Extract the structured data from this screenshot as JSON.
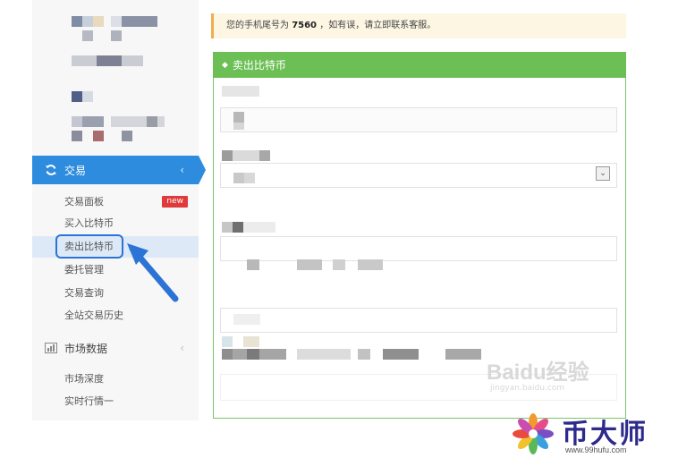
{
  "notice": {
    "prefix": "您的手机尾号为",
    "phone_tail": "7560",
    "suffix": "，如有误，请立即联系客服。"
  },
  "sidebar": {
    "trade_section": {
      "label": "交易",
      "chevron": "‹"
    },
    "trade_items": [
      {
        "label": "交易面板",
        "badge": "new"
      },
      {
        "label": "买入比特币"
      },
      {
        "label": "卖出比特币"
      },
      {
        "label": "委托管理"
      },
      {
        "label": "交易查询"
      },
      {
        "label": "全站交易历史"
      }
    ],
    "market_section": {
      "label": "市场数据",
      "chevron": "‹"
    },
    "market_items": [
      {
        "label": "市场深度"
      },
      {
        "label": "实时行情一"
      }
    ]
  },
  "panel": {
    "title": "卖出比特币",
    "select_indicator": "⌄"
  },
  "watermark": {
    "baidu": "Baidu经验",
    "baidu_url": "jingyan.baidu.com"
  },
  "brand": {
    "name": "币大师",
    "url": "www.99hufu.com"
  },
  "colors": {
    "sidebar_active": "#2d8cde",
    "panel_green": "#6cbf55",
    "new_badge": "#e03a3a",
    "brand_text": "#2d2a8c"
  }
}
